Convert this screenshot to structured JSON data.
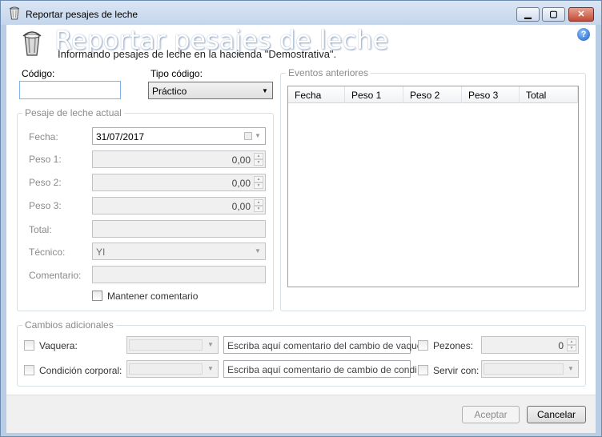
{
  "window": {
    "title": "Reportar pesajes de leche"
  },
  "header": {
    "title": "Reportar pesajes de leche",
    "subtitle": "Informando pesajes de leche en la hacienda \"Demostrativa\".",
    "help_glyph": "?"
  },
  "codigo": {
    "label": "Código:",
    "value": ""
  },
  "tipo_codigo": {
    "label": "Tipo código:",
    "selected": "Práctico"
  },
  "pesaje_actual": {
    "title": "Pesaje de leche actual",
    "fecha_label": "Fecha:",
    "fecha_value": "31/07/2017",
    "peso1_label": "Peso 1:",
    "peso1_value": "0,00",
    "peso2_label": "Peso 2:",
    "peso2_value": "0,00",
    "peso3_label": "Peso 3:",
    "peso3_value": "0,00",
    "total_label": "Total:",
    "total_value": "",
    "tecnico_label": "Técnico:",
    "tecnico_value": "YI",
    "comentario_label": "Comentario:",
    "comentario_value": "",
    "mantener_label": "Mantener comentario"
  },
  "eventos": {
    "title": "Eventos anteriores",
    "columns": [
      "Fecha",
      "Peso 1",
      "Peso 2",
      "Peso 3",
      "Total"
    ]
  },
  "cambios": {
    "title": "Cambios adicionales",
    "vaquera_label": "Vaquera:",
    "vaquera_comment_placeholder": "Escriba aquí comentario del cambio de vaque",
    "condicion_label": "Condición corporal:",
    "condicion_comment_placeholder": "Escriba aquí comentario de cambio de condi",
    "pezones_label": "Pezones:",
    "pezones_value": "0",
    "servir_label": "Servir con:"
  },
  "footer": {
    "accept_label": "Aceptar",
    "cancel_label": "Cancelar"
  }
}
